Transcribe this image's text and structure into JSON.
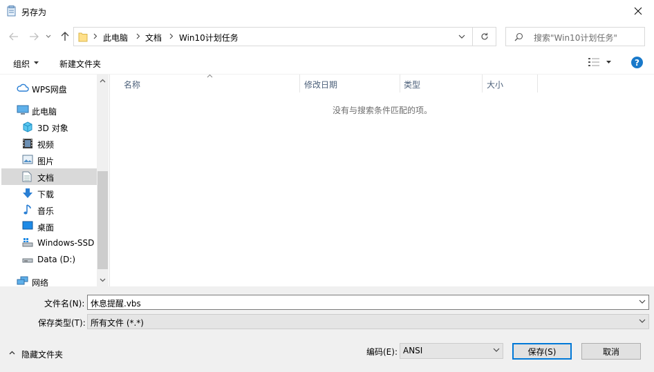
{
  "window": {
    "title": "另存为"
  },
  "address": {
    "breadcrumbs": [
      "此电脑",
      "文档",
      "Win10计划任务"
    ],
    "search_placeholder": "搜索\"Win10计划任务\""
  },
  "toolbar": {
    "organize_label": "组织",
    "new_folder_label": "新建文件夹"
  },
  "nav": {
    "items": [
      {
        "label": "WPS网盘",
        "icon": "cloud-icon"
      },
      {
        "label": "此电脑",
        "icon": "computer-icon"
      },
      {
        "label": "3D 对象",
        "icon": "cube-icon"
      },
      {
        "label": "视频",
        "icon": "film-icon"
      },
      {
        "label": "图片",
        "icon": "picture-icon"
      },
      {
        "label": "文档",
        "icon": "document-icon",
        "selected": true
      },
      {
        "label": "下载",
        "icon": "download-arrow-icon"
      },
      {
        "label": "音乐",
        "icon": "music-note-icon"
      },
      {
        "label": "桌面",
        "icon": "desktop-icon"
      },
      {
        "label": "Windows-SSD",
        "icon": "drive-icon"
      },
      {
        "label": "Data (D:)",
        "icon": "drive-icon"
      },
      {
        "label": "网络",
        "icon": "network-icon"
      }
    ]
  },
  "file_list": {
    "columns": [
      "名称",
      "修改日期",
      "类型",
      "大小"
    ],
    "empty_message": "没有与搜索条件匹配的项。"
  },
  "form": {
    "filename_label": "文件名(N):",
    "filename_value": "休息提醒.vbs",
    "filetype_label": "保存类型(T):",
    "filetype_value": "所有文件  (*.*)",
    "hide_folders_label": "隐藏文件夹",
    "encoding_label": "编码(E):",
    "encoding_value": "ANSI",
    "save_label": "保存(S)",
    "cancel_label": "取消"
  },
  "colors": {
    "accent": "#0078d7",
    "selected_bg": "#d9d9d9",
    "header_text": "#4c607a",
    "help": "#1979ca"
  }
}
